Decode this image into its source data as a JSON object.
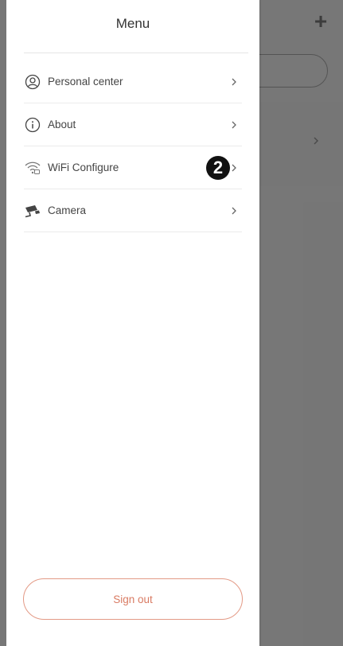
{
  "colors": {
    "accent": "#d97b63",
    "overlay": "#5a5a5a",
    "text": "#444444"
  },
  "background_app": {
    "add_icon": "plus-icon",
    "add_glyph": "+"
  },
  "drawer": {
    "title": "Menu",
    "items": [
      {
        "label": "Personal center",
        "icon": "user-icon"
      },
      {
        "label": "About",
        "icon": "info-icon"
      },
      {
        "label": "WiFi Configure",
        "icon": "wifi-icon",
        "step_badge": "2"
      },
      {
        "label": "Camera",
        "icon": "camera-icon"
      }
    ],
    "sign_out_label": "Sign out"
  }
}
